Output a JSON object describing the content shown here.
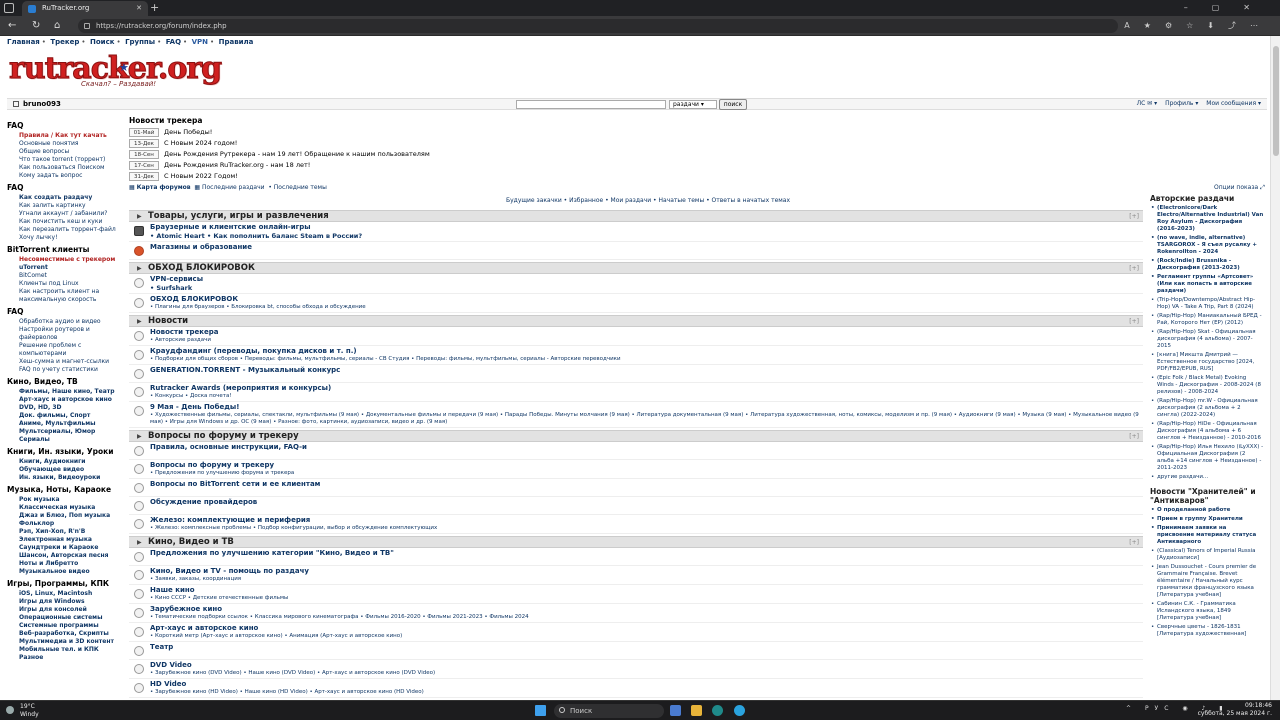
{
  "browser": {
    "tab_title": "RuTracker.org",
    "url": "https://rutracker.org/forum/index.php"
  },
  "topmenu": [
    "Главная",
    "Трекер",
    "Поиск",
    "Группы",
    "FAQ",
    "VPN",
    "Правила"
  ],
  "logo": {
    "text": "rutracker.org",
    "tagline": "Скачал? – Раздавай!"
  },
  "userbar": {
    "username": "bruno093",
    "search_select": "раздачи",
    "search_button": "поиск",
    "menu": [
      "ЛС ✉ ▾",
      "Профиль ▾",
      "Мои сообщения ▾"
    ]
  },
  "left": {
    "sections": [
      {
        "head": "FAQ",
        "items": [
          {
            "t": "Правила / Как тут качать",
            "c": "red b"
          },
          {
            "t": "Основные понятия"
          },
          {
            "t": "Общие вопросы"
          },
          {
            "t": "Что такое torrent (торрент)"
          },
          {
            "t": "Как пользоваться Поиском"
          },
          {
            "t": "Кому задать вопрос"
          }
        ]
      },
      {
        "head": "FAQ",
        "items": [
          {
            "t": "Как создать раздачу",
            "c": "b"
          },
          {
            "t": "Как залить картинку"
          },
          {
            "t": "Угнали аккаунт / забанили?"
          },
          {
            "t": "Как почистить кеш и куки"
          },
          {
            "t": "Как перезалить торрент-файл"
          },
          {
            "t": "Хочу лычку!"
          }
        ]
      },
      {
        "head": "BitTorrent клиенты",
        "items": [
          {
            "t": "Несовместимые с трекером",
            "c": "red b"
          },
          {
            "t": "uTorrent",
            "c": "b"
          },
          {
            "t": "BitComet"
          },
          {
            "t": "Клиенты под Linux"
          },
          {
            "t": "Как настроить клиент на"
          },
          {
            "t": "максимальную скорость"
          }
        ]
      },
      {
        "head": "FAQ",
        "items": [
          {
            "t": "Обработка аудио и видео"
          },
          {
            "t": "Настройки роутеров и файерволов"
          },
          {
            "t": "Решение проблем с компьютерами"
          },
          {
            "t": "Хеш-сумма и магнет-ссылки"
          },
          {
            "t": "FAQ по учету статистики"
          }
        ]
      },
      {
        "head": "Кино, Видео, ТВ",
        "items": [
          {
            "t": "Фильмы, Наше кино, Театр",
            "c": "b"
          },
          {
            "t": "Арт-хаус и авторское кино",
            "c": "b"
          },
          {
            "t": "DVD, HD, 3D",
            "c": "b"
          },
          {
            "t": "Док. фильмы, Спорт",
            "c": "b"
          },
          {
            "t": "Аниме, Мультфильмы",
            "c": "b"
          },
          {
            "t": "Мультсериалы, Юмор",
            "c": "b"
          },
          {
            "t": "Сериалы",
            "c": "b"
          }
        ]
      },
      {
        "head": "Книги, Ин. языки, Уроки",
        "items": [
          {
            "t": "Книги, Аудиокниги",
            "c": "b"
          },
          {
            "t": "Обучающее видео",
            "c": "b"
          },
          {
            "t": "Ин. языки, Видеоуроки",
            "c": "b"
          }
        ]
      },
      {
        "head": "Музыка, Ноты, Караоке",
        "items": [
          {
            "t": "Рок музыка",
            "c": "b"
          },
          {
            "t": "Классическая музыка",
            "c": "b"
          },
          {
            "t": "Джаз и Блюз, Поп музыка",
            "c": "b"
          },
          {
            "t": "Фольклор",
            "c": "b"
          },
          {
            "t": "Рэп, Хип-Хоп, R'n'B",
            "c": "b"
          },
          {
            "t": "Электронная музыка",
            "c": "b"
          },
          {
            "t": "Саундтреки и Караоке",
            "c": "b"
          },
          {
            "t": "Шансон, Авторская песня",
            "c": "b"
          },
          {
            "t": "Ноты и Либретто",
            "c": "b"
          },
          {
            "t": "Музыкальное видео",
            "c": "b"
          }
        ]
      },
      {
        "head": "Игры, Программы, КПК",
        "items": [
          {
            "t": "iOS, Linux, Macintosh",
            "c": "b"
          },
          {
            "t": "Игры для Windows",
            "c": "b"
          },
          {
            "t": "Игры для консолей",
            "c": "b"
          },
          {
            "t": "Операционные системы",
            "c": "b"
          },
          {
            "t": "Системные программы",
            "c": "b"
          },
          {
            "t": "Веб-разработка, Скрипты",
            "c": "b"
          },
          {
            "t": "Мультимедиа и 3D контент",
            "c": "b"
          },
          {
            "t": "Мобильные тел. и КПК",
            "c": "b"
          },
          {
            "t": "Разное",
            "c": "b"
          }
        ]
      }
    ]
  },
  "news": {
    "title": "Новости трекера",
    "rows": [
      {
        "date": "01-Май",
        "text": "День Победы!"
      },
      {
        "date": "13-Дек",
        "text": "С Новым 2024 годом!"
      },
      {
        "date": "18-Сен",
        "text": "День Рождения Рутрекера - нам 19 лет! Обращение к нашим пользователям"
      },
      {
        "date": "17-Сен",
        "text": "День Рождения RuTracker.org - нам 18 лет!"
      },
      {
        "date": "31-Дек",
        "text": "С Новым 2022 Годом!"
      }
    ]
  },
  "maplinks": {
    "map": "Карта форумов",
    "recent": "Последние раздачи",
    "topics": "Последние темы"
  },
  "options": "Опции показа",
  "quicklinks": "Будущие закачки  •  Избранное  •  Мои раздачи  •  Начатые темы  •  Ответы в начатых темах",
  "forums": [
    {
      "cat": "Товары, услуги, игры и развлечения",
      "rows": [
        {
          "icon": "game",
          "name": "Браузерные и клиентские онлайн-игры",
          "subs_b": "• Atomic Heart  •  Как пополнить баланс Steam в России?"
        },
        {
          "icon": "shop",
          "name": "Магазины и образование"
        }
      ]
    },
    {
      "cat": "ОБХОД БЛОКИРОВОК",
      "rows": [
        {
          "name": "VPN-сервисы",
          "subs_b": "• Surfshark"
        },
        {
          "name": "ОБХОД БЛОКИРОВОК",
          "subs": "• Плагины для браузеров  •  Блокировка bt, способы обхода и обсуждение"
        }
      ]
    },
    {
      "cat": "Новости",
      "rows": [
        {
          "name": "Новости трекера",
          "subs": "• Авторские раздачи"
        },
        {
          "name": "Краудфандинг (переводы, покупка дисков и т. п.)",
          "subs": "• Подборки для общих сборов  •  Переводы: фильмы, мультфильмы, сериалы - СВ Студия  •  Переводы: фильмы, мультфильмы, сериалы - Авторские переводчики"
        },
        {
          "name": "GENERATION.TORRENT - Музыкальный конкурс"
        },
        {
          "name": "Rutracker Awards (мероприятия и конкурсы)",
          "subs": "• Конкурсы  •  Доска почета!"
        },
        {
          "name": "9 Мая - День Победы!",
          "subs": "• Художественные фильмы, сериалы, спектакли, мультфильмы (9 мая)  •  Документальные фильмы и передачи (9 мая)  •  Парады Победы. Минуты молчания (9 мая)  •  Литература документальная (9 мая)  •  Литература художественная, ноты, комиксы, моделизм и пр. (9 мая)  •  Аудиокниги (9 мая)  •  Музыка (9 мая)  •  Музыкальное видео (9 мая)  •  Игры для Windows и др. ОС (9 мая)  •  Разное: фото, картинки, аудиозаписи, видео и др. (9 мая)"
        }
      ]
    },
    {
      "cat": "Вопросы по форуму и трекеру",
      "rows": [
        {
          "name": "Правила, основные инструкции, FAQ-и"
        },
        {
          "name": "Вопросы по форуму и трекеру",
          "subs": "• Предложения по улучшению форума и трекера"
        },
        {
          "name": "Вопросы по BitTorrent сети и ее клиентам"
        },
        {
          "name": "Обсуждение провайдеров"
        },
        {
          "name": "Железо: комплектующие и периферия",
          "subs": "• Железо: комплексные проблемы  •  Подбор конфигурации, выбор и обсуждение комплектующих"
        }
      ]
    },
    {
      "cat": "Кино, Видео и ТВ",
      "rows": [
        {
          "name": "Предложения по улучшению категории \"Кино, Видео и ТВ\""
        },
        {
          "name": "Кино, Видео и TV - помощь по раздачу",
          "subs": "• Заявки, заказы, координация"
        },
        {
          "name": "Наше кино",
          "subs": "• Кино СССР  •  Детские отечественные фильмы"
        },
        {
          "name": "Зарубежное кино",
          "subs": "• Тематические подборки ссылок  •  Классика мирового кинематографа  •  Фильмы 2016-2020  •  Фильмы 2021-2023  •  Фильмы 2024"
        },
        {
          "name": "Арт-хаус и авторское кино",
          "subs": "• Короткий метр (Арт-хаус и авторское кино)  •  Анимация (Арт-хаус и авторское кино)"
        },
        {
          "name": "Театр"
        },
        {
          "name": "DVD Video",
          "subs": "• Зарубежное кино (DVD Video)  •  Наше кино (DVD Video)  •  Арт-хаус и авторское кино (DVD Video)"
        },
        {
          "name": "HD Video",
          "subs": "• Зарубежное кино (HD Video)  •  Наше кино (HD Video)  •  Арт-хаус и авторское кино (HD Video)"
        }
      ]
    }
  ],
  "right": {
    "head1": "Авторские раздачи",
    "items1": [
      {
        "t": "(Electronicore/Dark Electro/Alternative Industrial) Van Roy Asylum - Дискография (2016-2023)",
        "b": true
      },
      {
        "t": "(no wave, indie, alternative) TSARGOROX - Я съел русалку + Rokenrollton - 2024",
        "b": true
      },
      {
        "t": "(Rock/Indie) Brussnika - Дискография (2013-2023)",
        "b": true
      },
      {
        "t": "Регламент группы «Артсовет» (Или как попасть в авторские раздачи)",
        "b": true
      },
      {
        "t": "(Trip-Hop/Downtempo/Abstract Hip-Hop) VA - Take A Trip, Part 8 (2024)"
      },
      {
        "t": "(Rap/Hip-Hop) Маниакальный БРЕД - Рай, Которого Нет (EP) (2012)"
      },
      {
        "t": "(Rap/Hip-Hop) Skat - Официальная дискография (4 альбома) - 2007-2015"
      },
      {
        "t": "[книга] Микшта Дмитрий — Естественное государство [2024, PDF/FB2/EPUB, RUS]"
      },
      {
        "t": "(Epic Folk / Black Metal) Evoking Winds - Дискография - 2008-2024 (8 релизов) - 2008-2024"
      },
      {
        "t": "(Rap/Hip-Hop) mr.W - Официальная дискография (2 альбома + 2 сингла) (2022-2024)"
      },
      {
        "t": "(Rap/Hip-Hop) HiDe - Официальная Дискография (4 альбома + 6 синглов + Неизданное) - 2010-2016"
      },
      {
        "t": "(Rap/Hip-Hop) Илья Нехило (iLyXXX) - Официальная Дискография (2 альба +14 синглов + Неизданное) - 2011-2023"
      },
      {
        "t": "другие раздачи..."
      }
    ],
    "head2": "Новости \"Хранителей\" и \"Антикваров\"",
    "items2": [
      {
        "t": "О проделанной работе",
        "b": true
      },
      {
        "t": "Прием в группу Хранители",
        "b": true
      },
      {
        "t": "Принимаем заявки на присвоение материалу статуса Антикварного",
        "b": true
      },
      {
        "t": "(Classical) Tenors of Imperial Russia [Аудиозаписи]"
      },
      {
        "t": "Jean Dussouchet - Cours premier de Grammaire Française. Brevet élémentaire / Начальный курс грамматики французского языка [Литература учебная]"
      },
      {
        "t": "Сабинин С.К. - Грамматика Исландского языка, 1849 [Литература учебная]"
      },
      {
        "t": "Сверчные цветы - 1826-1831 [Литература художественная]"
      }
    ]
  },
  "taskbar": {
    "temp": "19°C",
    "weather": "Windy",
    "search": "Поиск",
    "lang": "РУС",
    "time": "09:18:46",
    "date": "суббота, 25 мая 2024 г."
  }
}
